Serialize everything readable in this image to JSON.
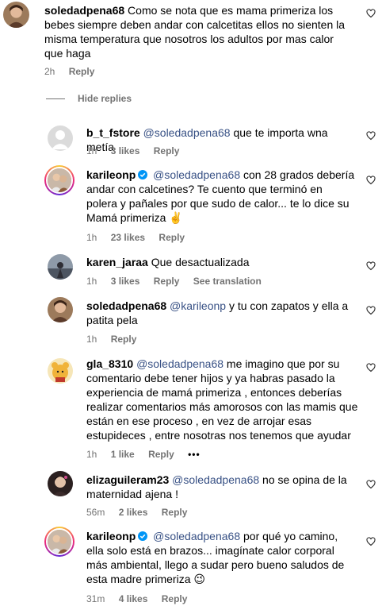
{
  "comments": [
    {
      "username": "soledadpena68",
      "mention": "",
      "text": "Como se nota que es mama primeriza los bebes siempre deben andar con calcetitas ellos no sienten la misma temperatura que nosotros los adultos por mas calor que haga",
      "time": "2h",
      "likes": "",
      "reply": "Reply"
    },
    {
      "username": "b_t_fstore",
      "mention": "@soledadpena68",
      "text": " que te importa wna metía",
      "time": "1h",
      "likes": "3 likes",
      "reply": "Reply"
    },
    {
      "username": "karileonp",
      "mention": "@soledadpena68",
      "text": " con 28 grados debería andar con calcetines? Te cuento que terminó en polera y pañales por que sudo de calor... te lo dice su Mamá primeriza ✌️",
      "time": "1h",
      "likes": "23 likes",
      "reply": "Reply"
    },
    {
      "username": "karen_jaraa",
      "mention": "",
      "text": "Que desactualizada",
      "time": "1h",
      "likes": "3 likes",
      "reply": "Reply",
      "translation": "See translation"
    },
    {
      "username": "soledadpena68",
      "mention": "@karileonp",
      "text": " y tu con zapatos y ella a patita pela",
      "time": "1h",
      "likes": "",
      "reply": "Reply"
    },
    {
      "username": "gla_8310",
      "mention": "@soledadpena68",
      "text": " me imagino que por su comentario debe tener hijos y ya habras pasado la experiencia de mamá primeriza , entonces deberías realizar comentarios más amorosos con las mamis que están en ese proceso , en vez de arrojar esas estupideces , entre nosotras nos tenemos que ayudar",
      "time": "1h",
      "likes": "1 like",
      "reply": "Reply",
      "more": "•••"
    },
    {
      "username": "elizaguileram23",
      "mention": "@soledadpena68",
      "text": " no se opina de la maternidad ajena !",
      "time": "56m",
      "likes": "2 likes",
      "reply": "Reply"
    },
    {
      "username": "karileonp",
      "mention": "@soledadpena68",
      "text": " por qué yo camino, ella solo está en brazos... imagínate calor corporal más ambiental, llego a sudar pero bueno saludos de esta madre primeriza 😉",
      "time": "31m",
      "likes": "4 likes",
      "reply": "Reply"
    }
  ],
  "hide_replies": "Hide replies",
  "colors": {
    "mention": "#385185",
    "meta": "#737373",
    "verified": "#0095f6"
  },
  "icons": [
    "heart-outline-icon",
    "verified-badge-icon",
    "more-options-icon"
  ]
}
